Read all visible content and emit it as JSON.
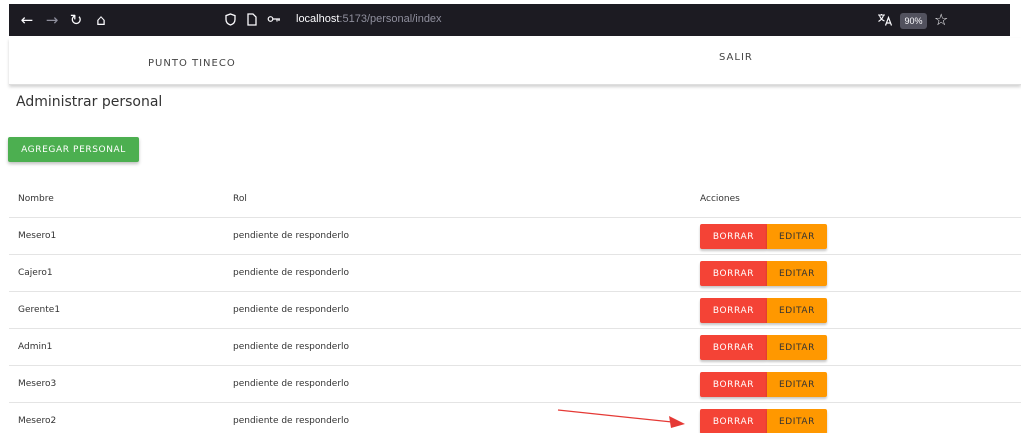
{
  "browser": {
    "url_host": "localhost",
    "url_path": ":5173/personal/index",
    "zoom": "90%"
  },
  "header": {
    "brand": "PUNTO TINECO",
    "logout": "SALIR"
  },
  "page": {
    "title": "Administrar personal",
    "add_button": "AGREGAR PERSONAL"
  },
  "table": {
    "headers": [
      "Nombre",
      "Rol",
      "Acciones"
    ],
    "rows": [
      {
        "name": "Mesero1",
        "role": "pendiente de responderlo"
      },
      {
        "name": "Cajero1",
        "role": "pendiente de responderlo"
      },
      {
        "name": "Gerente1",
        "role": "pendiente de responderlo"
      },
      {
        "name": "Admin1",
        "role": "pendiente de responderlo"
      },
      {
        "name": "Mesero3",
        "role": "pendiente de responderlo"
      },
      {
        "name": "Mesero2",
        "role": "pendiente de responderlo"
      }
    ],
    "delete_label": "BORRAR",
    "edit_label": "EDITAR"
  },
  "colors": {
    "browser_bg": "#1c1b22",
    "add_button": "#4caf50",
    "delete_button": "#f44336",
    "edit_button": "#ff9800",
    "annotation": "#e53935"
  }
}
